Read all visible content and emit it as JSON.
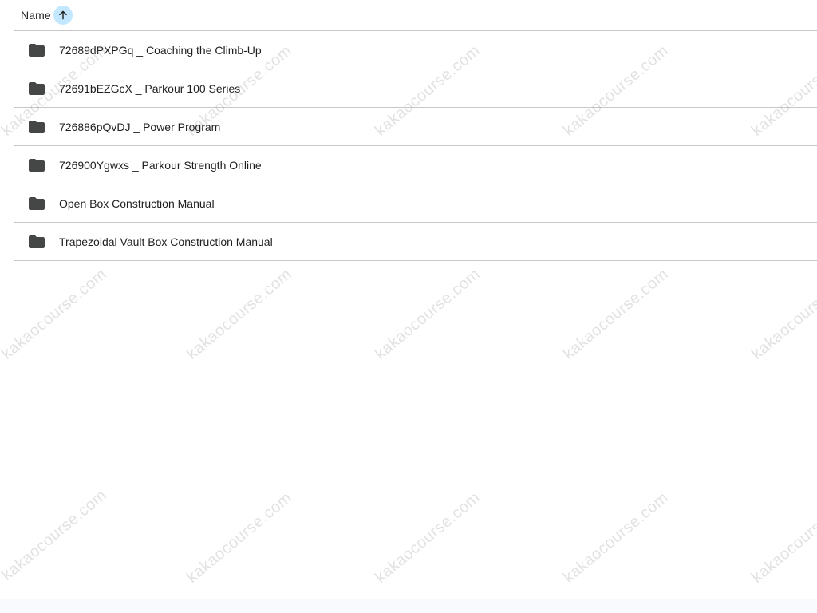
{
  "header": {
    "sort_label": "Name",
    "sort_icon": "arrow-up-icon"
  },
  "rows": [
    {
      "label": "72689dPXPGq _ Coaching the Climb-Up",
      "icon": "folder-icon"
    },
    {
      "label": "72691bEZGcX _ Parkour 100 Series",
      "icon": "folder-icon"
    },
    {
      "label": "726886pQvDJ _ Power Program",
      "icon": "folder-icon"
    },
    {
      "label": "726900Ygwxs _ Parkour Strength Online",
      "icon": "folder-icon"
    },
    {
      "label": "Open Box Construction Manual",
      "icon": "folder-icon"
    },
    {
      "label": "Trapezoidal Vault Box Construction Manual",
      "icon": "folder-icon"
    }
  ],
  "watermark": "kakaocourse.com",
  "colors": {
    "sort_highlight": "#c2e7ff",
    "folder": "#444746",
    "divider": "#c7c7c7"
  }
}
